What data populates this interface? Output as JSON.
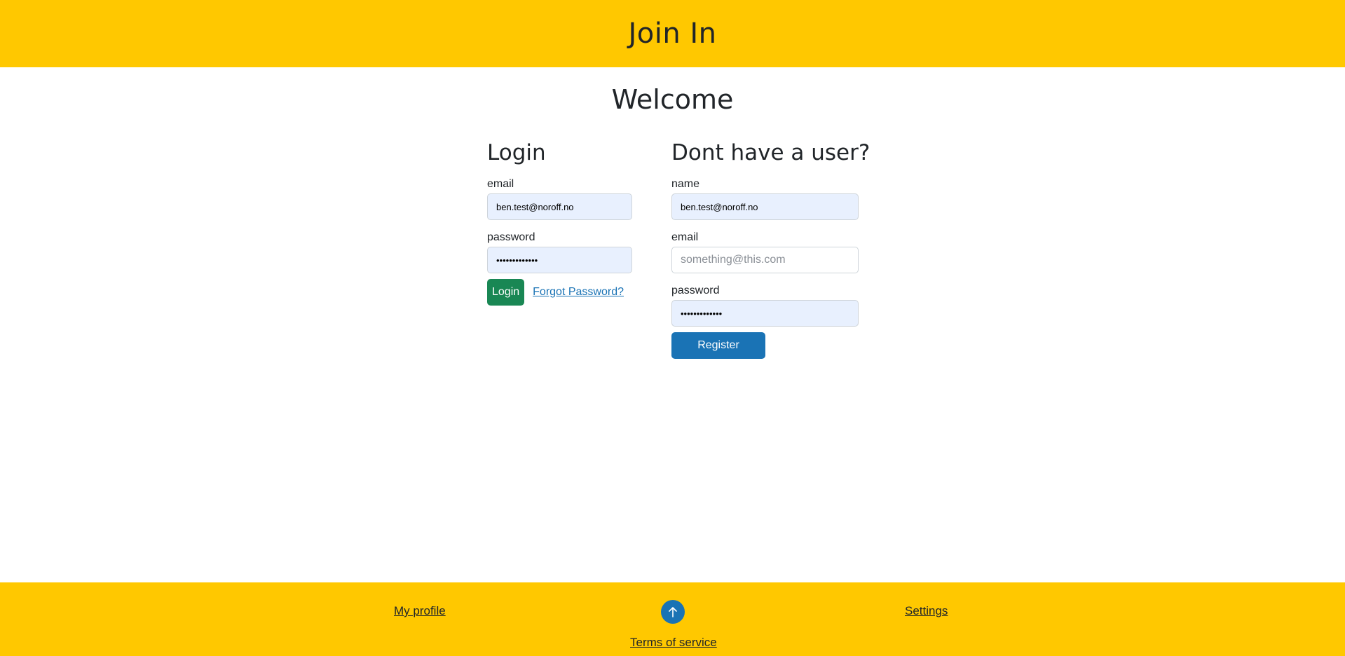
{
  "header": {
    "title": "Join In"
  },
  "welcome": "Welcome",
  "login": {
    "heading": "Login",
    "email_label": "email",
    "email_value": "ben.test@noroff.no",
    "password_label": "password",
    "password_value": "•••••••••••••",
    "login_label": "Login",
    "forgot_label": "Forgot Password?"
  },
  "register": {
    "heading": "Dont have a user?",
    "name_label": "name",
    "name_value": "ben.test@noroff.no",
    "email_label": "email",
    "email_placeholder": "something@this.com",
    "password_label": "password",
    "password_value": "•••••••••••••",
    "register_label": "Register"
  },
  "footer": {
    "profile_label": "My profile",
    "settings_label": "Settings",
    "terms_label": "Terms of service",
    "scroll_icon": "arrow-up-icon"
  },
  "colors": {
    "header_bg": "#ffc800",
    "login_btn": "#198754",
    "register_btn": "#1a73b5",
    "input_autofill_bg": "#e8f0fe"
  }
}
